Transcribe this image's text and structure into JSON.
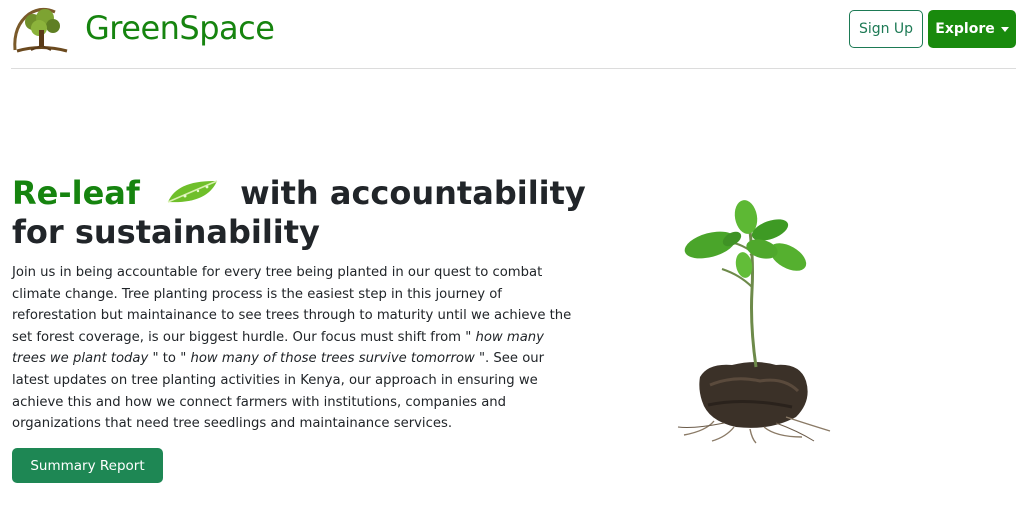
{
  "header": {
    "brand": "GreenSpace",
    "logo_icon": "tree-logo-icon",
    "signup_label": "Sign Up",
    "explore_label": "Explore"
  },
  "hero": {
    "title_highlight": "Re-leaf",
    "title_rest": "with accountability for sustainability",
    "leaf_icon": "leaf-icon",
    "para_1": "Join us in being accountable for every tree being planted in our quest to combat climate change. Tree planting process is the easiest step in this journey of reforestation but maintainance to see trees through to maturity until we achieve the set forest coverage, is our biggest hurdle. Our focus must shift from \"",
    "quote_1": " how many trees we plant today ",
    "para_2": "\" to \"",
    "quote_2": " how many of those trees survive tomorrow ",
    "para_3": "\". See our latest updates on tree planting activities in Kenya, our approach in ensuring we achieve this and how we connect farmers with institutions, companies and organizations that need tree seedlings and maintainance services.",
    "summary_button": "Summary Report",
    "image_icon": "seedling-image"
  },
  "colors": {
    "brand_green": "#16840f",
    "explore_green": "#198a0d",
    "summary_green": "#1e8754",
    "outline_green": "#1d7a55"
  }
}
